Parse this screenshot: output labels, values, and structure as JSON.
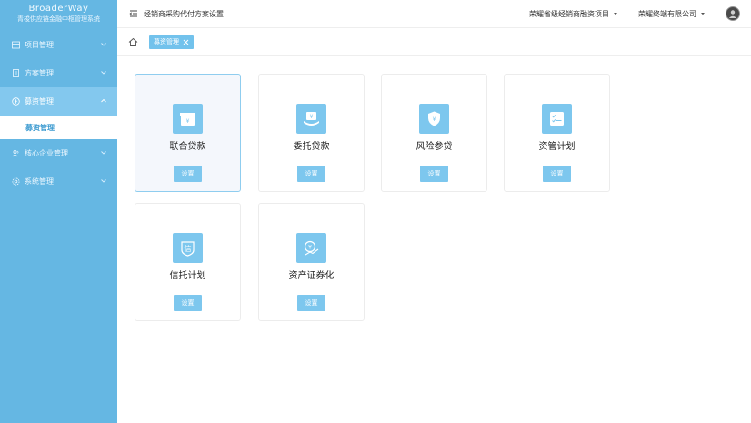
{
  "sidebar": {
    "logo_title": "BroaderWay",
    "logo_subtitle": "青梭供应链金融中枢管理系统",
    "items": [
      {
        "label": "项目管理",
        "icon": "table-icon"
      },
      {
        "label": "方案管理",
        "icon": "document-icon"
      },
      {
        "label": "募资管理",
        "icon": "coin-icon",
        "active": true,
        "subitems": [
          {
            "label": "募资管理"
          }
        ]
      },
      {
        "label": "核心企业管理",
        "icon": "users-icon"
      },
      {
        "label": "系统管理",
        "icon": "gear-icon"
      }
    ]
  },
  "topbar": {
    "title": "经销商采购代付方案设置",
    "project_select": "荣耀省级经销商融资项目",
    "company_select": "荣耀终端有限公司"
  },
  "tabs": [
    {
      "label": "募资管理"
    }
  ],
  "cards": [
    {
      "title": "联合贷款",
      "button": "设置",
      "icon": "yuan-box-icon",
      "selected": true
    },
    {
      "title": "委托贷款",
      "button": "设置",
      "icon": "yuan-hand-icon"
    },
    {
      "title": "风险参贷",
      "button": "设置",
      "icon": "shield-yuan-icon"
    },
    {
      "title": "资管计划",
      "button": "设置",
      "icon": "checklist-icon"
    },
    {
      "title": "信托计划",
      "button": "设置",
      "icon": "trust-badge-icon"
    },
    {
      "title": "资产证券化",
      "button": "设置",
      "icon": "securities-icon"
    }
  ],
  "colors": {
    "sidebar": "#65b7e3",
    "accent": "#7dc7ee",
    "active_menu": "#83c8ee"
  }
}
